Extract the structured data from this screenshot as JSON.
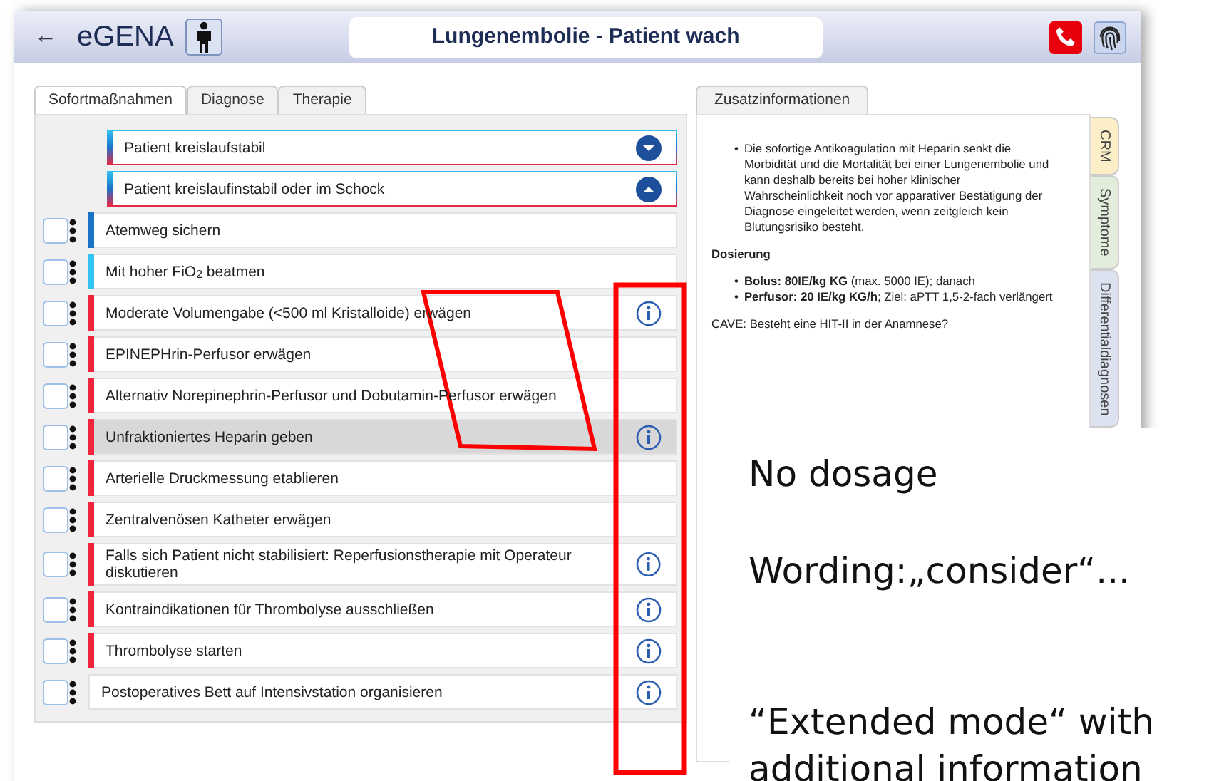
{
  "header": {
    "back": "←",
    "app_name": "eGENA",
    "title": "Lungenembolie - Patient wach"
  },
  "left_tabs": [
    {
      "label": "Sofortmaßnahmen",
      "selected": true
    },
    {
      "label": "Diagnose",
      "selected": false
    },
    {
      "label": "Therapie",
      "selected": false
    }
  ],
  "rows": [
    {
      "kind": "group",
      "text": "Patient kreislaufstabil",
      "expanded": false
    },
    {
      "kind": "group",
      "text": "Patient kreislaufinstabil oder im Schock",
      "expanded": true
    },
    {
      "kind": "item",
      "text": "Atemweg sichern",
      "color": "#1a73c9",
      "checked": false,
      "info": false,
      "selected": false
    },
    {
      "kind": "item",
      "text": "Mit hoher FiO$_{2}$ beatmen",
      "color": "#33c3f0",
      "checked": false,
      "info": false,
      "selected": false
    },
    {
      "kind": "item",
      "text": "Moderate Volumengabe (<500 ml Kristalloide) erwägen",
      "color": "#f0243c",
      "checked": false,
      "info": true,
      "selected": false
    },
    {
      "kind": "item",
      "text": "EPINEPHrin-Perfusor erwägen",
      "color": "#f0243c",
      "checked": false,
      "info": false,
      "selected": false
    },
    {
      "kind": "item",
      "text": "Alternativ Norepinephrin-Perfusor und Dobutamin-Perfusor erwägen",
      "color": "#f0243c",
      "checked": false,
      "info": false,
      "selected": false
    },
    {
      "kind": "item",
      "text": "Unfraktioniertes Heparin geben",
      "color": "#f0243c",
      "checked": false,
      "info": true,
      "selected": true
    },
    {
      "kind": "item",
      "text": "Arterielle Druckmessung etablieren",
      "color": "#f0243c",
      "checked": false,
      "info": false,
      "selected": false
    },
    {
      "kind": "item",
      "text": "Zentralvenösen Katheter erwägen",
      "color": "#f0243c",
      "checked": false,
      "info": false,
      "selected": false
    },
    {
      "kind": "item",
      "text": "Falls sich Patient nicht stabilisiert: Reperfusionstherapie mit Operateur diskutieren",
      "color": "#f0243c",
      "checked": false,
      "info": true,
      "selected": false
    },
    {
      "kind": "item",
      "text": "Kontraindikationen für Thrombolyse ausschließen",
      "color": "#f0243c",
      "checked": false,
      "info": true,
      "selected": false
    },
    {
      "kind": "item",
      "text": "Thrombolyse starten",
      "color": "#f0243c",
      "checked": false,
      "info": true,
      "selected": false
    },
    {
      "kind": "item",
      "text": "Postoperatives Bett auf Intensivstation organisieren",
      "checked": false,
      "info": true,
      "selected": false
    }
  ],
  "info_panel": {
    "tab": "Zusatzinformationen",
    "bullet": "•",
    "intro_bullets": [
      "Die sofortige Antikoagulation mit Heparin senkt die Morbidität und die Mortalität bei einer Lungenembolie und kann deshalb bereits bei hoher klinischer Wahrscheinlichkeit noch vor apparativer Bestätigung der Diagnose eingeleitet werden, wenn zeitgleich kein Blutungsrisiko besteht."
    ],
    "heading": "Dosierung",
    "dose_bullets": [
      "**Bolus: 80IE/kg KG** (max. 5000 IE); danach",
      "**Perfusor: 20 IE/kg KG/h**; Ziel: aPTT 1,5-2-fach verlängert"
    ],
    "note": "CAVE: Besteht eine HIT-II in der Anamnese?"
  },
  "side_tabs": [
    {
      "label": "CRM",
      "color": "#fcefc7"
    },
    {
      "label": "Symptome",
      "color": "#e2eedb"
    },
    {
      "label": "Differentialdiagnosen",
      "color": "#dde2f1"
    }
  ],
  "annotations": [
    "No dosage",
    "Wording:„consider“...",
    "“Extended mode“ with",
    "additional information"
  ]
}
